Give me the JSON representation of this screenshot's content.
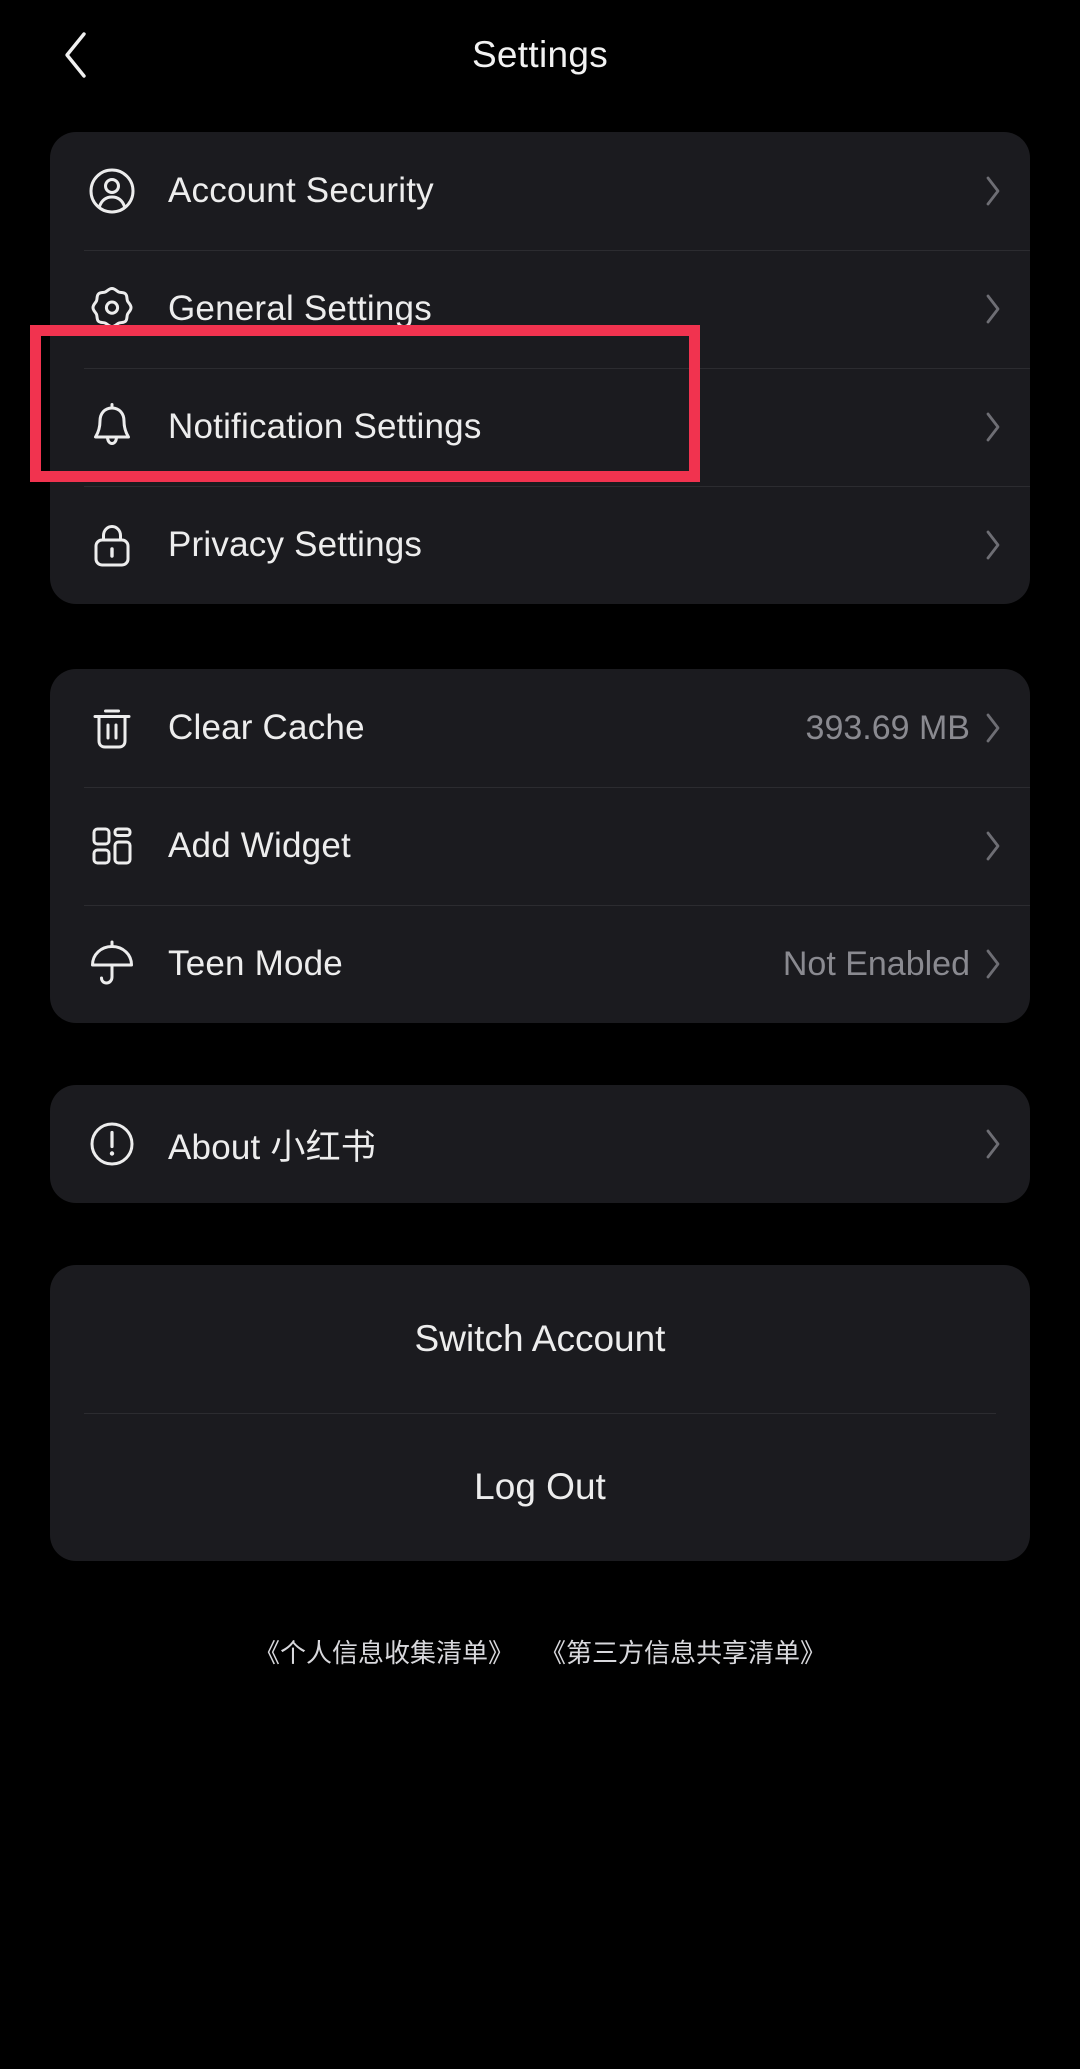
{
  "header": {
    "title": "Settings",
    "back_icon": "chevron-left-icon"
  },
  "sections": {
    "settings_group": [
      {
        "icon": "account-circle-icon",
        "label": "Account Security",
        "value": ""
      },
      {
        "icon": "gear-icon",
        "label": "General Settings",
        "value": ""
      },
      {
        "icon": "bell-icon",
        "label": "Notification Settings",
        "value": ""
      },
      {
        "icon": "lock-icon",
        "label": "Privacy Settings",
        "value": ""
      }
    ],
    "tools_group": [
      {
        "icon": "trash-icon",
        "label": "Clear Cache",
        "value": "393.69 MB"
      },
      {
        "icon": "widget-grid-icon",
        "label": "Add Widget",
        "value": ""
      },
      {
        "icon": "umbrella-icon",
        "label": "Teen Mode",
        "value": "Not Enabled"
      }
    ],
    "about_group": [
      {
        "icon": "exclamation-circle-icon",
        "label": "About 小红书",
        "value": ""
      }
    ],
    "account_actions": [
      {
        "label": "Switch Account"
      },
      {
        "label": "Log Out"
      }
    ]
  },
  "footer": {
    "links": [
      "《个人信息收集清单》",
      "《第三方信息共享清单》"
    ]
  },
  "annotation": {
    "target": "General Settings",
    "color": "#F1334F"
  },
  "colors": {
    "background": "#000000",
    "card": "#1B1B1F",
    "text_primary": "#EDEDED",
    "text_secondary": "#8A8A90",
    "divider": "#2C2C30",
    "accent": "#F1334F"
  }
}
